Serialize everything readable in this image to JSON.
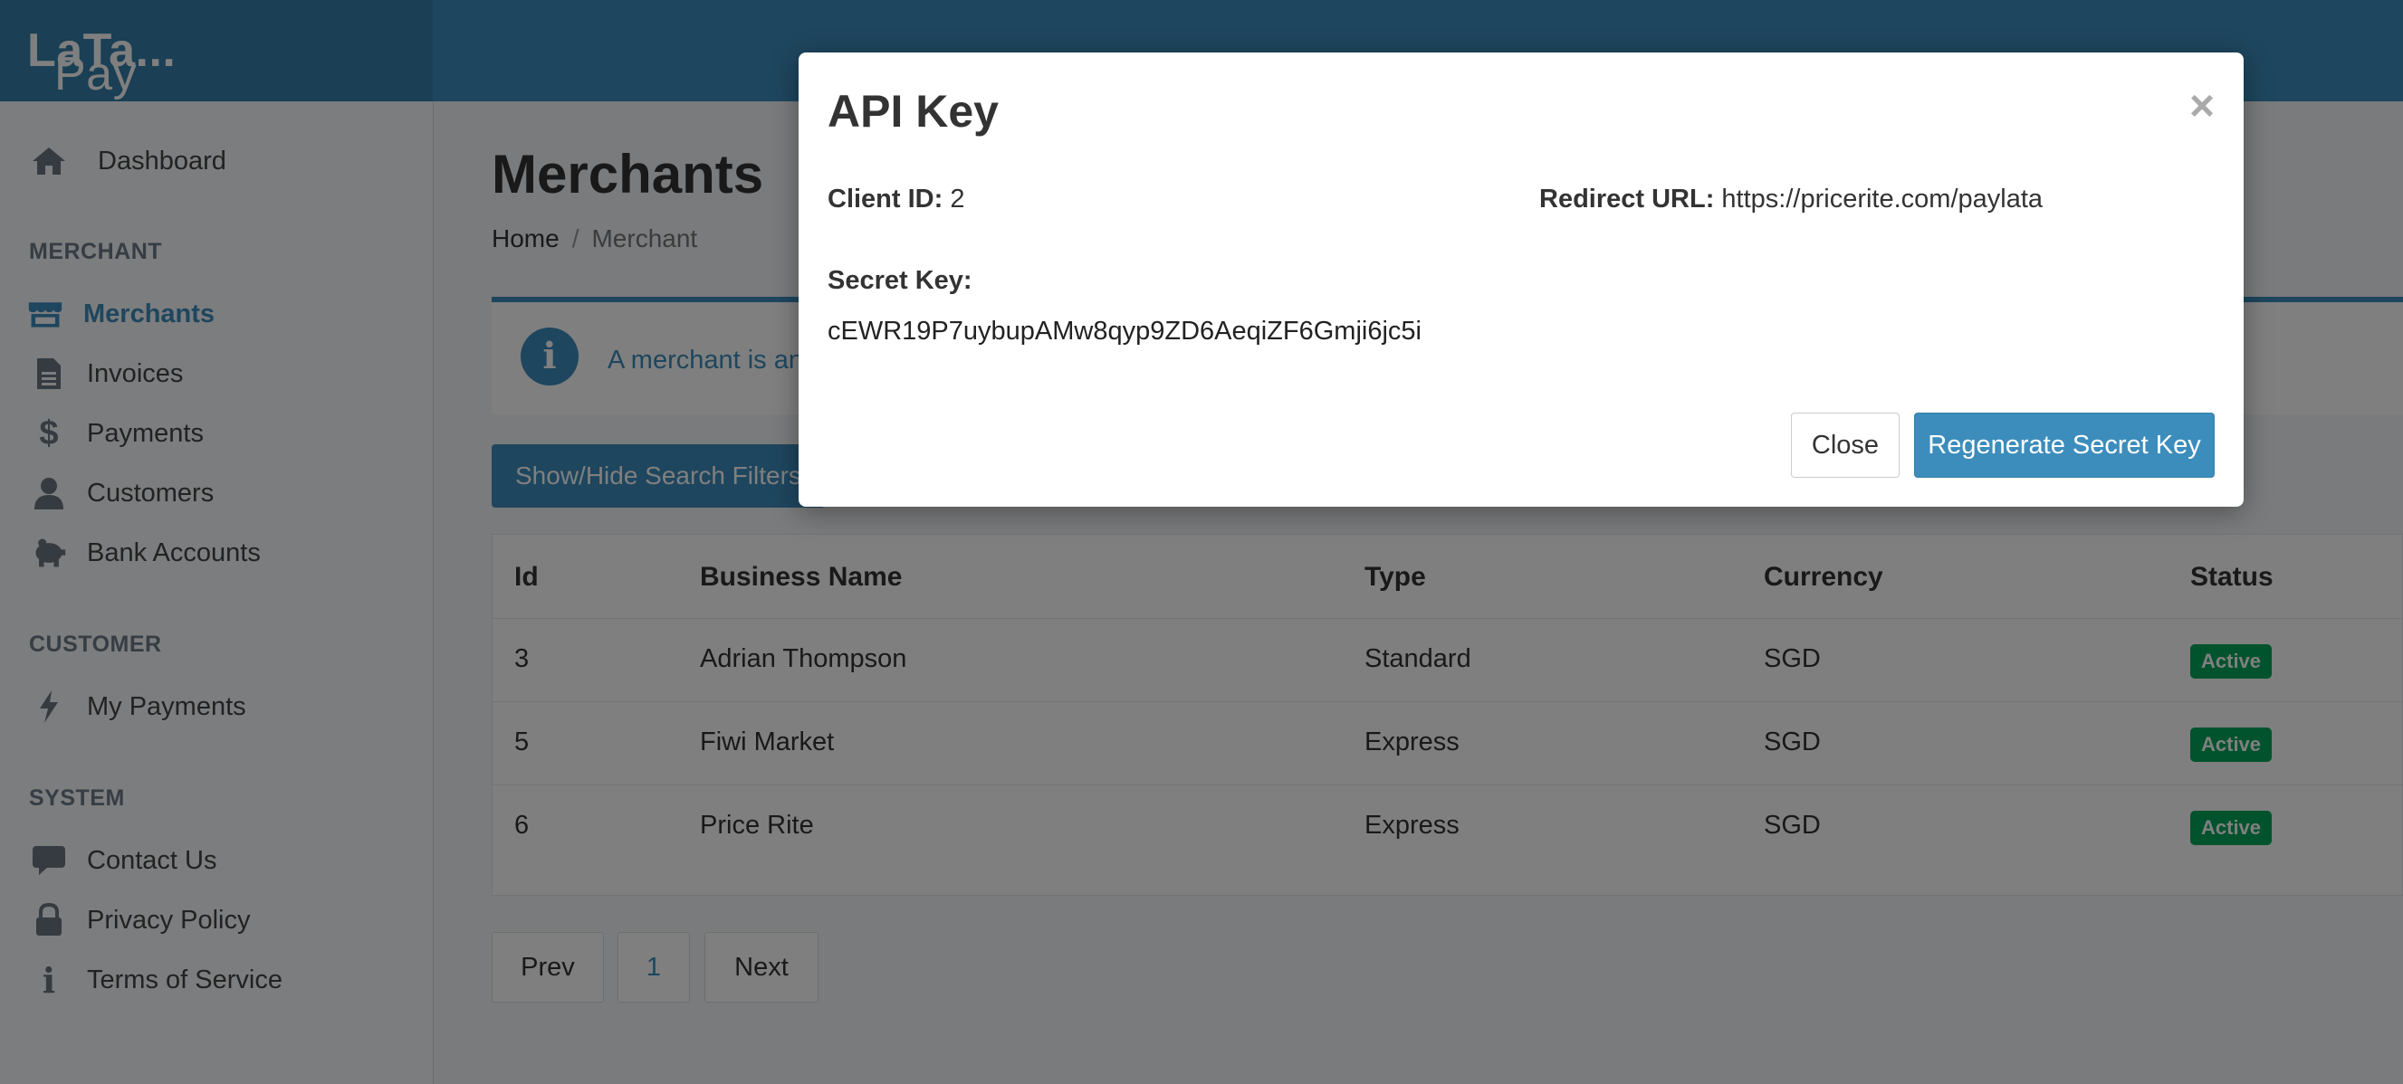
{
  "brand": {
    "light": "Pay",
    "bold": "LaTa..."
  },
  "sidebar": {
    "dashboard": "Dashboard",
    "merchant_header": "MERCHANT",
    "merchant_items": [
      "Merchants",
      "Invoices",
      "Payments",
      "Customers",
      "Bank Accounts"
    ],
    "customer_header": "CUSTOMER",
    "customer_items": [
      "My Payments"
    ],
    "system_header": "SYSTEM",
    "system_items": [
      "Contact Us",
      "Privacy Policy",
      "Terms of Service"
    ]
  },
  "page": {
    "title": "Merchants",
    "breadcrumb": {
      "home": "Home",
      "separator": "/",
      "current": "Merchant"
    },
    "info_text": "A merchant is an",
    "filter_button": "Show/Hide Search Filters"
  },
  "table": {
    "headers": [
      "Id",
      "Business Name",
      "Type",
      "Currency",
      "Status"
    ],
    "rows": [
      {
        "id": "3",
        "name": "Adrian Thompson",
        "type": "Standard",
        "currency": "SGD",
        "status": "Active"
      },
      {
        "id": "5",
        "name": "Fiwi Market",
        "type": "Express",
        "currency": "SGD",
        "status": "Active"
      },
      {
        "id": "6",
        "name": "Price Rite",
        "type": "Express",
        "currency": "SGD",
        "status": "Active"
      }
    ]
  },
  "pagination": {
    "prev": "Prev",
    "current": "1",
    "next": "Next"
  },
  "modal": {
    "title": "API Key",
    "close_symbol": "×",
    "client_id_label": "Client ID:",
    "client_id_value": "2",
    "redirect_label": "Redirect URL:",
    "redirect_value": "https://pricerite.com/paylata",
    "secret_label": "Secret Key:",
    "secret_value": "cEWR19P7uybupAMw8qyp9ZD6AeqiZF6Gmji6jc5i",
    "close_button": "Close",
    "regenerate_button": "Regenerate Secret Key"
  },
  "icons": {
    "dashboard": "home-icon",
    "merchants": "store-icon",
    "invoices": "file-icon",
    "payments": "dollar-icon",
    "customers": "user-icon",
    "bank_accounts": "piggy-bank-icon",
    "my_payments": "bolt-icon",
    "contact_us": "comment-icon",
    "privacy_policy": "lock-icon",
    "terms": "info-icon"
  },
  "colors": {
    "primary": "#3c8dbc",
    "topbar": "#3c8dbc",
    "brand": "#367fa9",
    "status_active": "#00a65a"
  }
}
